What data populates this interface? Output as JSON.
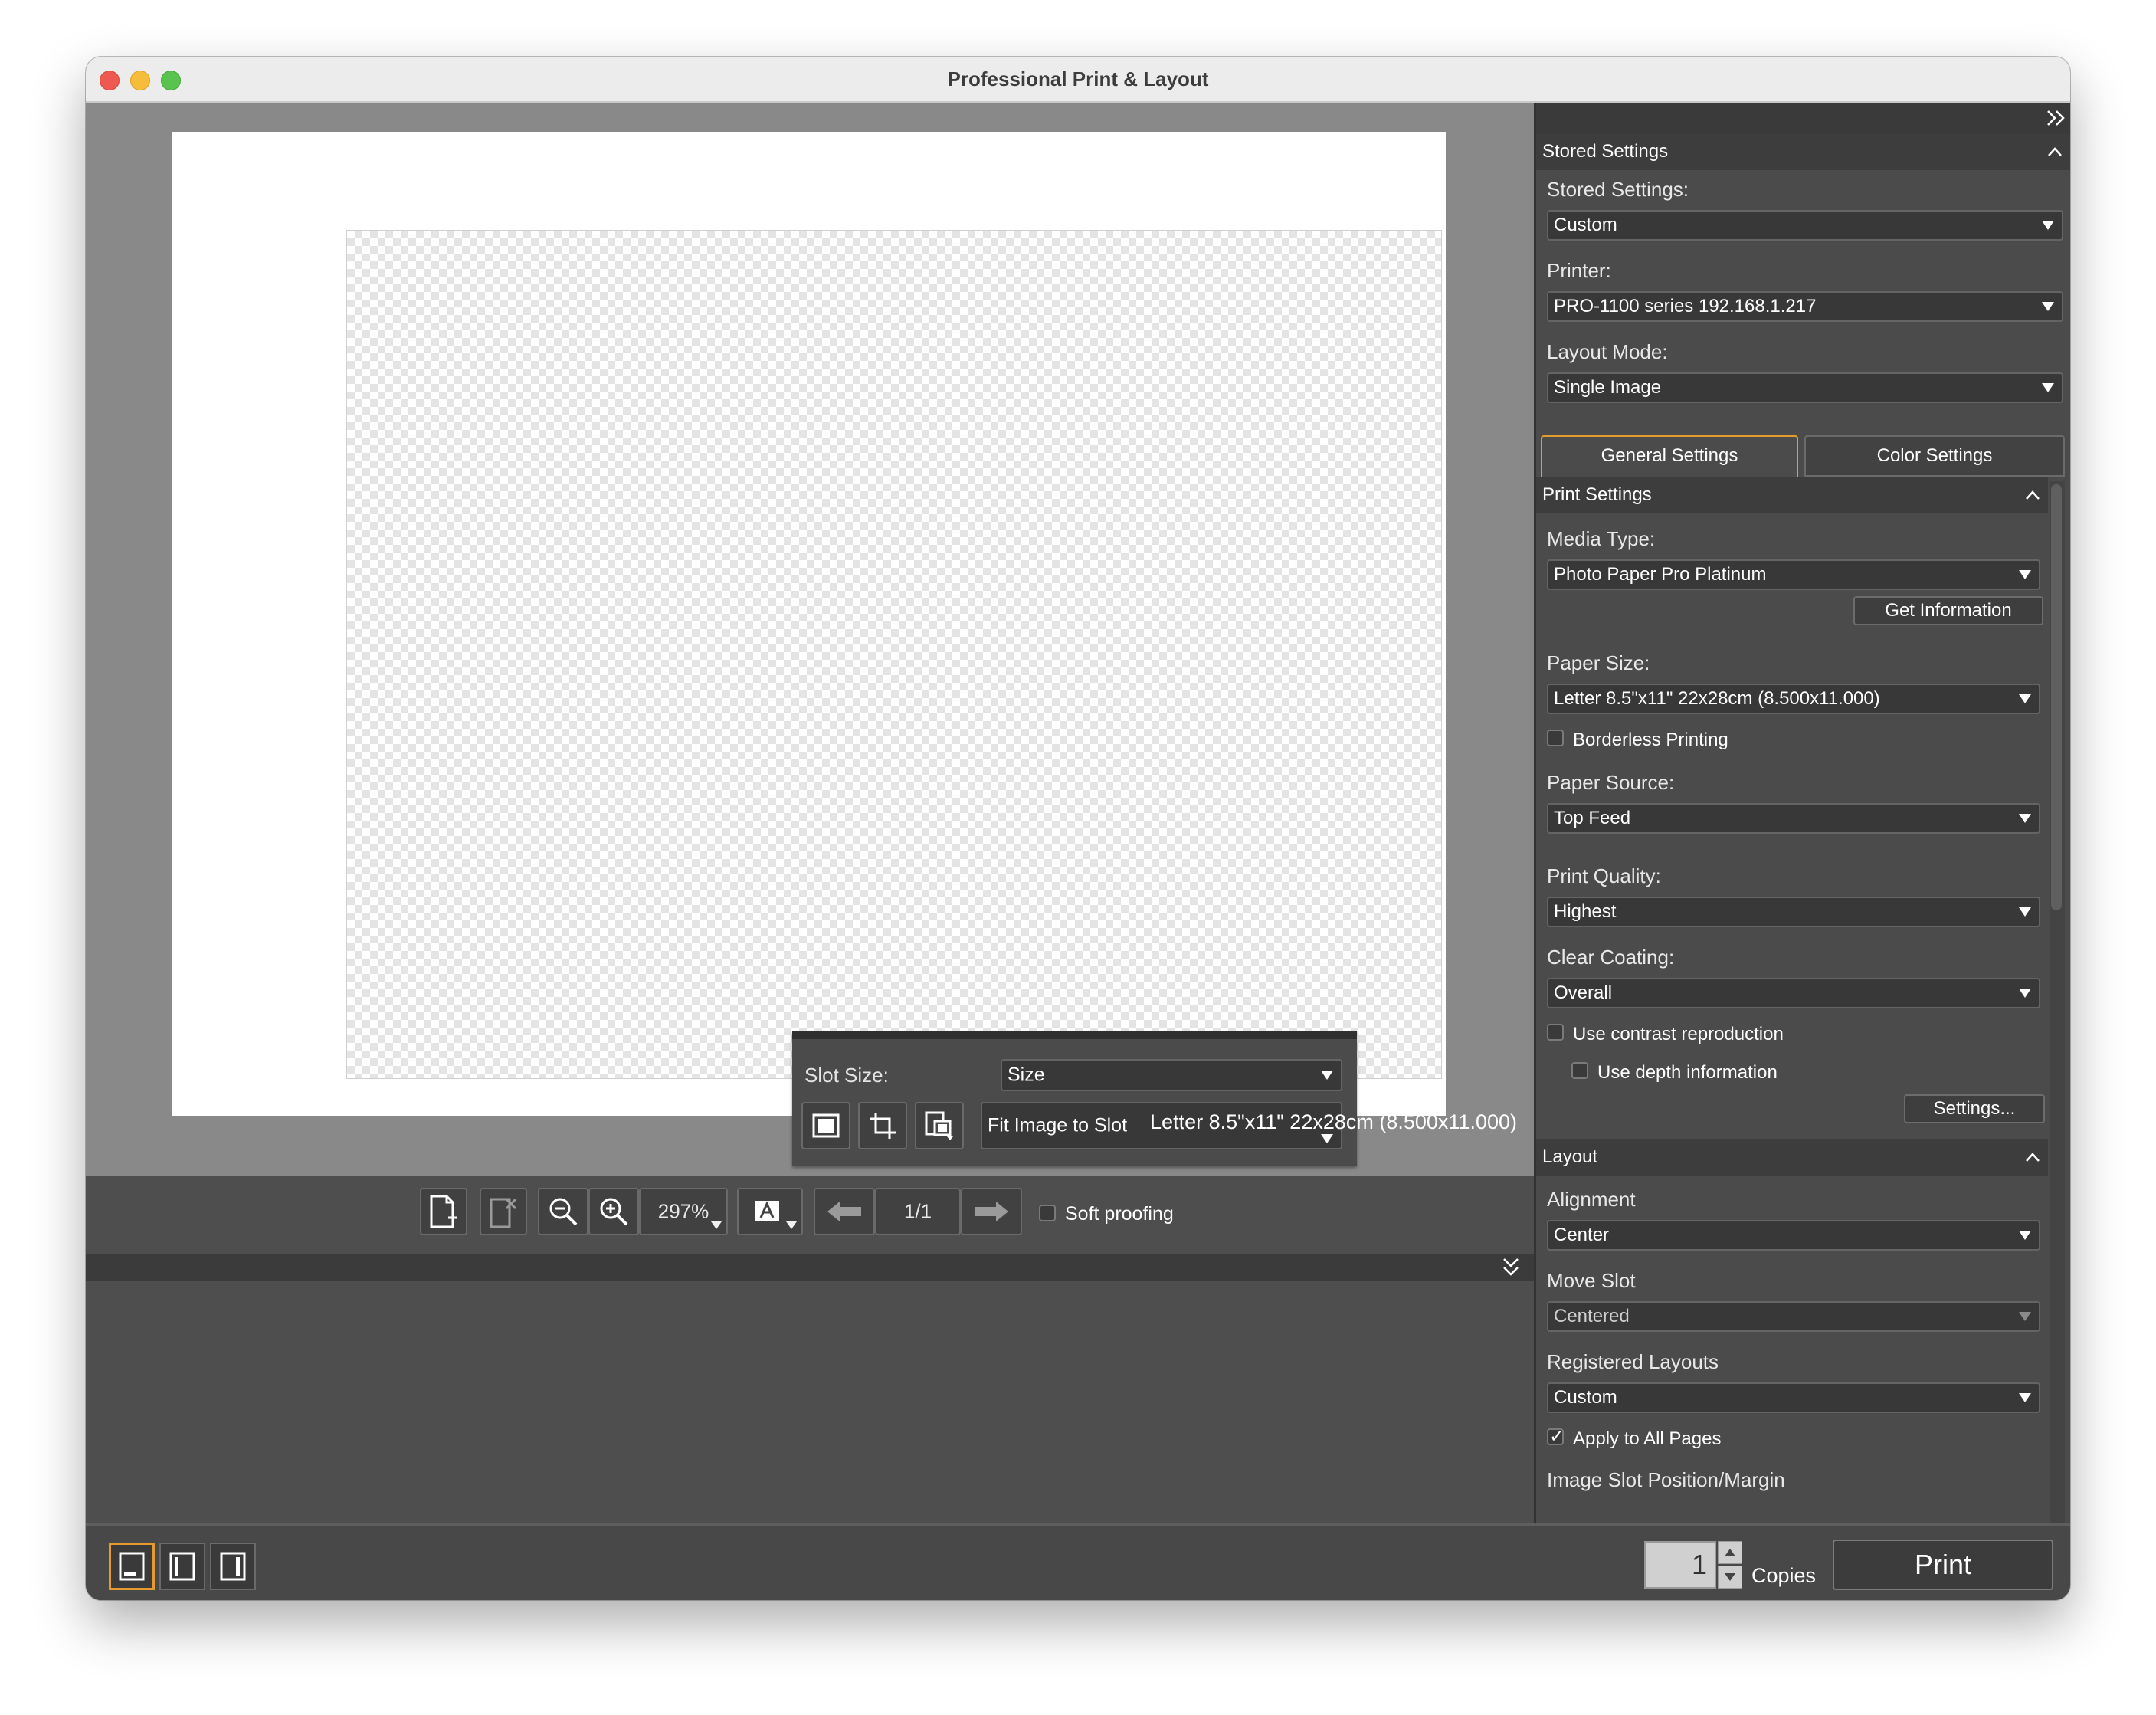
{
  "window": {
    "title": "Professional Print & Layout"
  },
  "canvas": {
    "paper_info": "Letter 8.5\"x11\" 22x28cm (8.500x11.000)",
    "slot": {
      "slot_size_label": "Slot Size:",
      "slot_size_value": "Size",
      "fit_value": "Fit Image to Slot"
    }
  },
  "toolbar": {
    "zoom": "297%",
    "page": "1/1",
    "soft_proofing": "Soft proofing",
    "soft_proofing_checked": false
  },
  "side": {
    "stored_section": "Stored Settings",
    "stored_settings_label": "Stored Settings:",
    "stored_settings_value": "Custom",
    "printer_label": "Printer:",
    "printer_value": "PRO-1100 series 192.168.1.217",
    "layout_mode_label": "Layout Mode:",
    "layout_mode_value": "Single Image",
    "tabs": [
      "General Settings",
      "Color Settings"
    ],
    "print_section": "Print Settings",
    "media_type_label": "Media Type:",
    "media_type_value": "Photo Paper Pro Platinum",
    "get_information": "Get Information",
    "paper_size_label": "Paper Size:",
    "paper_size_value": "Letter 8.5\"x11\" 22x28cm (8.500x11.000)",
    "borderless": "Borderless Printing",
    "borderless_checked": false,
    "paper_source_label": "Paper Source:",
    "paper_source_value": "Top Feed",
    "print_quality_label": "Print Quality:",
    "print_quality_value": "Highest",
    "clear_coating_label": "Clear Coating:",
    "clear_coating_value": "Overall",
    "contrast": "Use contrast reproduction",
    "contrast_checked": false,
    "depth": "Use depth information",
    "depth_checked": false,
    "settings_button": "Settings...",
    "layout_section": "Layout",
    "alignment_label": "Alignment",
    "alignment_value": "Center",
    "move_slot_label": "Move Slot",
    "move_slot_value": "Centered",
    "registered_layouts_label": "Registered Layouts",
    "registered_layouts_value": "Custom",
    "apply_all_pages": "Apply to All Pages",
    "apply_all_pages_checked": true,
    "image_slot_label": "Image Slot Position/Margin"
  },
  "bottom": {
    "copies_value": "1",
    "copies_label": "Copies",
    "print_button": "Print"
  },
  "colors": {
    "accent": "#e59a2e",
    "panel": "#4b4b4b",
    "canvas": "#898989"
  },
  "icons": [
    "add-page-icon",
    "remove-page-icon",
    "zoom-out-icon",
    "zoom-in-icon",
    "text-overlay-icon",
    "arrow-left-icon",
    "arrow-right-icon",
    "fit-icon",
    "crop-icon",
    "rotate-icon",
    "single-view-icon",
    "double-view-icon",
    "side-view-icon",
    "collapse-icon",
    "expand-icon"
  ]
}
